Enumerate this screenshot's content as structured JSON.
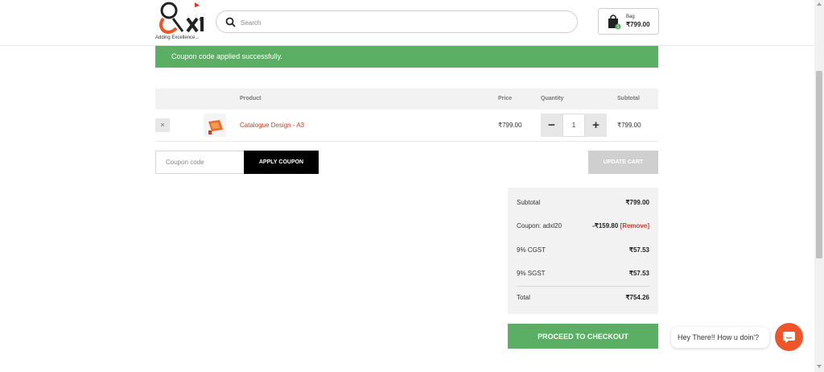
{
  "header": {
    "logo_text": "xl",
    "logo_tagline": "Adding Excellence...",
    "search_placeholder": "Search",
    "bag": {
      "label": "Bag",
      "total": "₹799.00",
      "count": "1"
    }
  },
  "notice": {
    "text": "Coupon code applied successfully."
  },
  "cart": {
    "columns": {
      "product": "Product",
      "price": "Price",
      "quantity": "Quantity",
      "subtotal": "Subtotal"
    },
    "items": [
      {
        "remove": "×",
        "name": "Catalogue Design - A3",
        "price": "₹799.00",
        "quantity": "1",
        "subtotal": "₹799.00",
        "minus": "−",
        "plus": "+"
      }
    ]
  },
  "coupon": {
    "placeholder": "Coupon code",
    "apply_label": "APPLY COUPON",
    "update_label": "UPDATE CART"
  },
  "totals": {
    "subtotal_label": "Subtotal",
    "subtotal_value": "₹799.00",
    "coupon_label": "Coupon: adxl20",
    "coupon_value": "-₹159.80",
    "coupon_remove": "[Remove]",
    "cgst_label": "9% CGST",
    "cgst_value": "₹57.53",
    "sgst_label": "9% SGST",
    "sgst_value": "₹57.53",
    "total_label": "Total",
    "total_value": "₹754.26"
  },
  "checkout": {
    "label": "PROCEED TO CHECKOUT"
  },
  "chat": {
    "greeting": "Hey There!! How u doin'?"
  },
  "colors": {
    "accent_green": "#5aaf64",
    "brand_orange": "#f0552a",
    "link_red": "#d0402a"
  }
}
